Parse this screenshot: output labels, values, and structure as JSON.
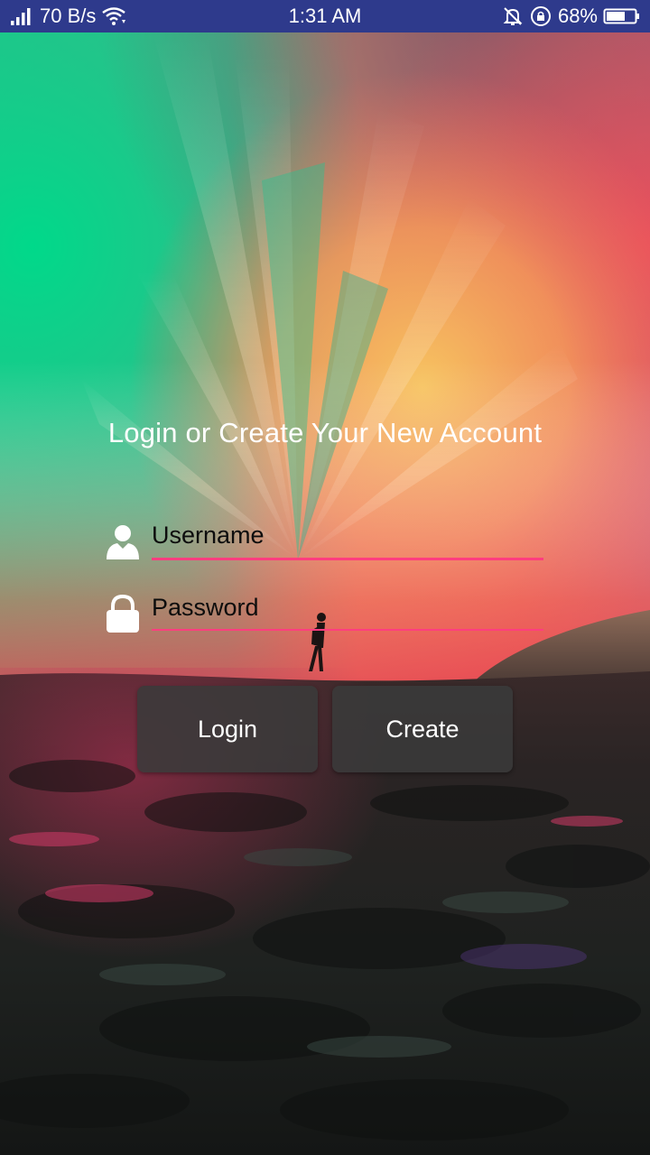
{
  "status_bar": {
    "network_speed": "70 B/s",
    "time": "1:31 AM",
    "battery_percent": "68%",
    "battery_level": 0.68,
    "icons": [
      "signal-icon",
      "wifi-icon",
      "mute-bell-icon",
      "rotation-lock-icon",
      "battery-icon"
    ]
  },
  "login": {
    "heading": "Login or Create Your New Account",
    "username_placeholder": "Username",
    "password_placeholder": "Password",
    "login_label": "Login",
    "create_label": "Create"
  },
  "colors": {
    "status_bar": "#2e3a8c",
    "field_underline": "#ff3d7f",
    "button_bg": "#3a3a3a"
  }
}
